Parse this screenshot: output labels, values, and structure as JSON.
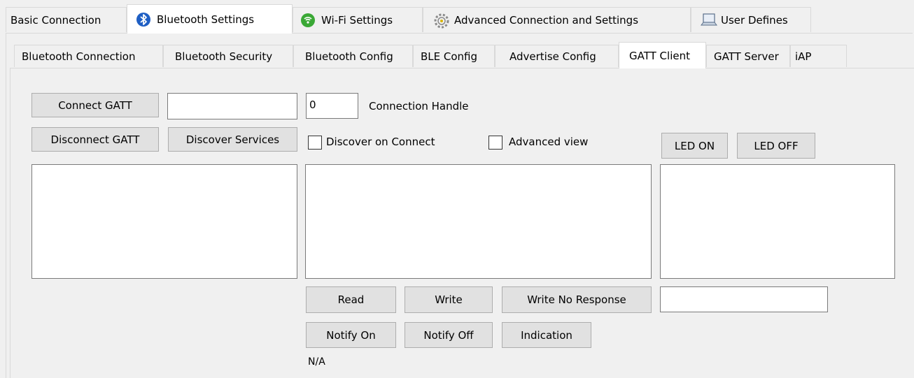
{
  "top_tabs": [
    {
      "label": "Basic Connection",
      "icon": ""
    },
    {
      "label": "Bluetooth Settings",
      "icon": "bluetooth-icon"
    },
    {
      "label": "Wi-Fi Settings",
      "icon": "wifi-icon"
    },
    {
      "label": "Advanced Connection and Settings",
      "icon": "gear-icon"
    },
    {
      "label": "User Defines",
      "icon": "laptop-icon"
    }
  ],
  "sub_tabs": [
    {
      "label": "Bluetooth Connection"
    },
    {
      "label": "Bluetooth Security"
    },
    {
      "label": "Bluetooth Config"
    },
    {
      "label": "BLE Config"
    },
    {
      "label": "Advertise Config"
    },
    {
      "label": "GATT Client"
    },
    {
      "label": "GATT Server"
    },
    {
      "label": "iAP"
    }
  ],
  "gatt": {
    "connect_button": "Connect GATT",
    "disconnect_button": "Disconnect GATT",
    "discover_services_button": "Discover Services",
    "address_value": "",
    "connection_handle_value": "0",
    "connection_handle_label": "Connection Handle",
    "discover_on_connect_label": "Discover on Connect",
    "advanced_view_label": "Advanced view",
    "led_on_button": "LED ON",
    "led_off_button": "LED OFF",
    "read_button": "Read",
    "write_button": "Write",
    "write_no_response_button": "Write No Response",
    "write_value": "",
    "notify_on_button": "Notify On",
    "notify_off_button": "Notify Off",
    "indication_button": "Indication",
    "status_text": "N/A"
  },
  "colors": {
    "window_bg": "#f0f0f0",
    "button_bg": "#e1e1e1",
    "button_border": "#adadad",
    "bluetooth_blue": "#1f5fc4",
    "wifi_green": "#3aa835"
  }
}
